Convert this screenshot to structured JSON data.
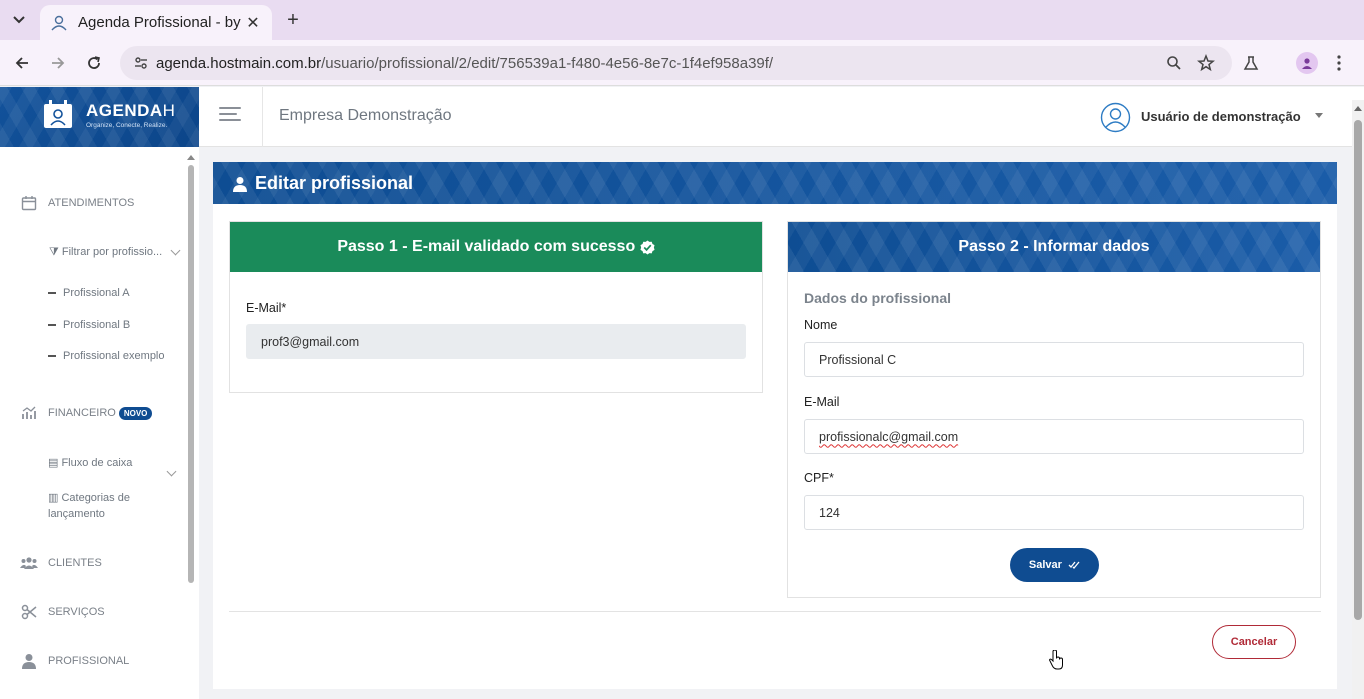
{
  "browser": {
    "tab_title": "Agenda Profissional - by",
    "url_domain": "agenda.hostmain.com.br",
    "url_path": "/usuario/profissional/2/edit/756539a1-f480-4e56-8e7c-1f4ef958a39f/"
  },
  "logo": {
    "name": "AGENDA",
    "suffix": "H",
    "tagline": "Organize, Conecte, Realize."
  },
  "header": {
    "company": "Empresa Demonstração",
    "user": "Usuário de demonstração"
  },
  "sidebar": {
    "atendimentos": "ATENDIMENTOS",
    "filter": "Filtrar por profissio...",
    "professionals": [
      "Profissional A",
      "Profissional B",
      "Profissional exemplo"
    ],
    "financeiro": "FINANCEIRO",
    "badge": "NOVO",
    "fluxo": "Fluxo de caixa",
    "categorias": "Categorias de lançamento",
    "clientes": "CLIENTES",
    "servicos": "SERVIÇOS",
    "profissional": "PROFISSIONAL"
  },
  "page": {
    "title": "Editar profissional"
  },
  "step1": {
    "title": "Passo 1 - E-mail validado com sucesso",
    "email_label": "E-Mail*",
    "email_value": "prof3@gmail.com"
  },
  "step2": {
    "title": "Passo 2 - Informar dados",
    "section": "Dados do profissional",
    "nome_label": "Nome",
    "nome_value": "Profissional C",
    "email_label": "E-Mail",
    "email_value": "profissionalc@gmail.com",
    "cpf_label": "CPF*",
    "cpf_value": "124",
    "save": "Salvar"
  },
  "cancel": "Cancelar",
  "colors": {
    "primary": "#0f4c91",
    "success": "#1a8b5a",
    "danger": "#b02a37"
  }
}
